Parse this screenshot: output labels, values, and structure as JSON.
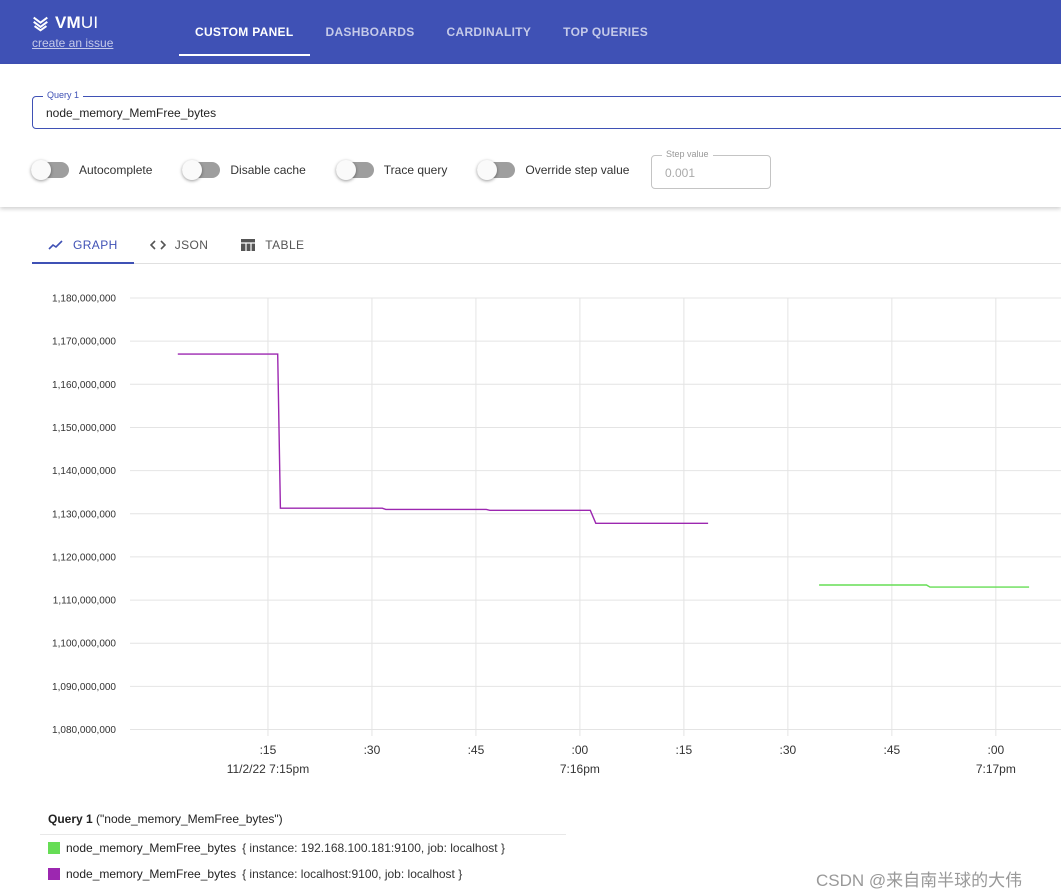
{
  "header": {
    "logo_bold": "VM",
    "logo_rest": "UI",
    "issue_link": "create an issue",
    "tabs": [
      {
        "label": "CUSTOM PANEL",
        "active": true
      },
      {
        "label": "DASHBOARDS",
        "active": false
      },
      {
        "label": "CARDINALITY",
        "active": false
      },
      {
        "label": "TOP QUERIES",
        "active": false
      }
    ]
  },
  "query": {
    "label": "Query 1",
    "value": "node_memory_MemFree_bytes"
  },
  "toggles": [
    {
      "label": "Autocomplete",
      "on": false
    },
    {
      "label": "Disable cache",
      "on": false
    },
    {
      "label": "Trace query",
      "on": false
    },
    {
      "label": "Override step value",
      "on": false
    }
  ],
  "step": {
    "label": "Step value",
    "placeholder": "0.001"
  },
  "display_tabs": [
    {
      "label": "GRAPH",
      "icon": "graph-icon",
      "active": true
    },
    {
      "label": "JSON",
      "icon": "code-icon",
      "active": false
    },
    {
      "label": "TABLE",
      "icon": "table-icon",
      "active": false
    }
  ],
  "chart_data": {
    "type": "line",
    "y_ticks": [
      "1,080,000,000",
      "1,090,000,000",
      "1,100,000,000",
      "1,110,000,000",
      "1,120,000,000",
      "1,130,000,000",
      "1,140,000,000",
      "1,150,000,000",
      "1,160,000,000",
      "1,170,000,000",
      "1,180,000,000"
    ],
    "ylim": [
      1078500000,
      1180000000
    ],
    "x_ticks": [
      {
        "label": ":15",
        "sub": "11/2/22 7:15pm",
        "t": 15
      },
      {
        "label": ":30",
        "sub": "",
        "t": 30
      },
      {
        "label": ":45",
        "sub": "",
        "t": 45
      },
      {
        "label": ":00",
        "sub": "7:16pm",
        "t": 60
      },
      {
        "label": ":15",
        "sub": "",
        "t": 75
      },
      {
        "label": ":30",
        "sub": "",
        "t": 90
      },
      {
        "label": ":45",
        "sub": "",
        "t": 105
      },
      {
        "label": ":00",
        "sub": "7:17pm",
        "t": 120
      },
      {
        "label": "",
        "sub": "",
        "t": 135
      }
    ],
    "x_unit": "seconds after 7:15:00pm",
    "grid": true,
    "series": [
      {
        "name": "node_memory_MemFree_bytes",
        "color": "#9c27b0",
        "points": [
          [
            2,
            1167000000
          ],
          [
            16.4,
            1167000000
          ],
          [
            16.8,
            1131300000
          ],
          [
            31.5,
            1131300000
          ],
          [
            32,
            1131000000
          ],
          [
            46.5,
            1131000000
          ],
          [
            47,
            1130800000
          ],
          [
            61.5,
            1130800000
          ],
          [
            62.3,
            1127800000
          ],
          [
            78.5,
            1127800000
          ]
        ]
      },
      {
        "name": "node_memory_MemFree_bytes",
        "color": "#66dd55",
        "points": [
          [
            94.5,
            1113500000
          ],
          [
            110,
            1113500000
          ],
          [
            110.5,
            1113000000
          ],
          [
            124.8,
            1113000000
          ]
        ]
      }
    ]
  },
  "legend": {
    "query_label": "Query 1",
    "query_expr": "(\"node_memory_MemFree_bytes\")",
    "items": [
      {
        "name": "node_memory_MemFree_bytes",
        "labels": "{ instance: 192.168.100.181:9100,  job: localhost }",
        "color": "#66dd55"
      },
      {
        "name": "node_memory_MemFree_bytes",
        "labels": "{ instance: localhost:9100,  job: localhost }",
        "color": "#9c27b0"
      }
    ]
  },
  "watermark": "CSDN @来自南半球的大伟"
}
